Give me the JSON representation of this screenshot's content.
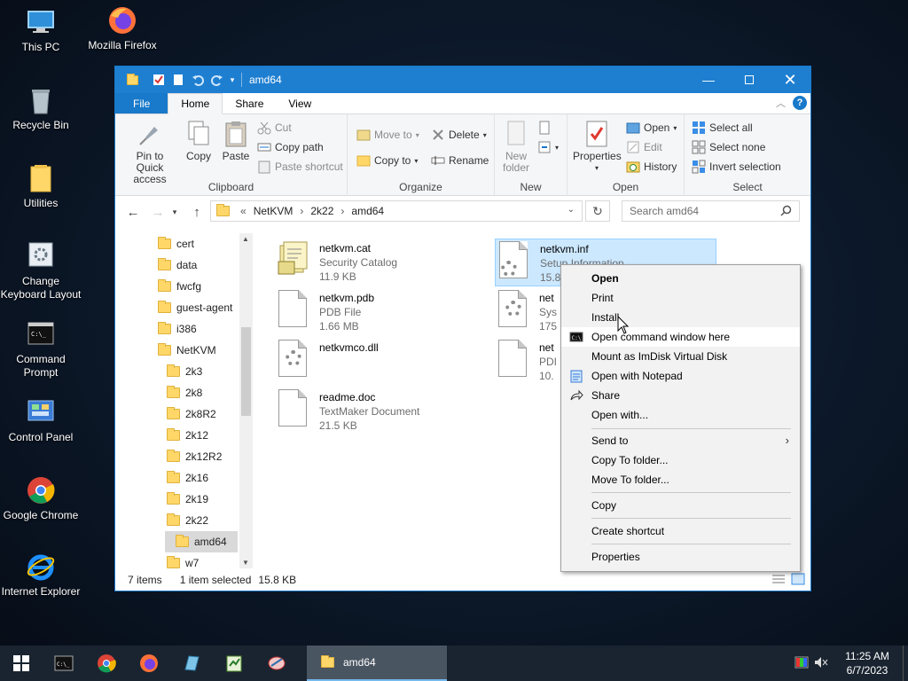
{
  "desktop": {
    "icons": [
      {
        "label": "This PC"
      },
      {
        "label": "Mozilla Firefox"
      },
      {
        "label": "Recycle Bin"
      },
      {
        "label": "Utilities"
      },
      {
        "label": "Change Keyboard Layout"
      },
      {
        "label": "Command Prompt"
      },
      {
        "label": "Control Panel"
      },
      {
        "label": "Google Chrome"
      },
      {
        "label": "Internet Explorer"
      }
    ]
  },
  "window": {
    "title": "amd64",
    "tabs": [
      "File",
      "Home",
      "Share",
      "View"
    ],
    "ribbon": {
      "clipboard": {
        "pin": "Pin to Quick access",
        "copy": "Copy",
        "paste": "Paste",
        "cut": "Cut",
        "copy_path": "Copy path",
        "paste_shortcut": "Paste shortcut",
        "label": "Clipboard"
      },
      "organize": {
        "move_to": "Move to",
        "copy_to": "Copy to",
        "delete": "Delete",
        "rename": "Rename",
        "label": "Organize"
      },
      "new": {
        "new_folder": "New folder",
        "label": "New"
      },
      "open": {
        "properties": "Properties",
        "open": "Open",
        "edit": "Edit",
        "history": "History",
        "label": "Open"
      },
      "select": {
        "select_all": "Select all",
        "select_none": "Select none",
        "invert": "Invert selection",
        "label": "Select"
      }
    },
    "address": {
      "crumbs": [
        "NetKVM",
        "2k22",
        "amd64"
      ],
      "overflow": "«"
    },
    "search": {
      "placeholder": "Search amd64"
    },
    "tree": [
      "cert",
      "data",
      "fwcfg",
      "guest-agent",
      "i386",
      "NetKVM",
      "2k3",
      "2k8",
      "2k8R2",
      "2k12",
      "2k12R2",
      "2k16",
      "2k19",
      "2k22",
      "amd64",
      "w7"
    ],
    "files": [
      {
        "name": "netkvm.cat",
        "type": "Security Catalog",
        "size": "11.9 KB"
      },
      {
        "name": "netkvm.inf",
        "type": "Setup Information",
        "size": "15.8"
      },
      {
        "name": "netkvm.pdb",
        "type": "PDB File",
        "size": "1.66 MB"
      },
      {
        "name": "net",
        "type": "Sys",
        "size": "175"
      },
      {
        "name": "netkvmco.dll",
        "type": "",
        "size": ""
      },
      {
        "name": "net",
        "type": "PDI",
        "size": "10."
      },
      {
        "name": "readme.doc",
        "type": "TextMaker Document",
        "size": "21.5 KB"
      }
    ],
    "status": {
      "count": "7 items",
      "selected": "1 item selected",
      "size": "15.8 KB"
    }
  },
  "context_menu": {
    "items": [
      {
        "label": "Open"
      },
      {
        "label": "Print"
      },
      {
        "label": "Install"
      },
      {
        "label": "Open command window here"
      },
      {
        "label": "Mount as ImDisk Virtual Disk"
      },
      {
        "label": "Open with Notepad"
      },
      {
        "label": "Share"
      },
      {
        "label": "Open with..."
      },
      {
        "label": "Send to"
      },
      {
        "label": "Copy To folder..."
      },
      {
        "label": "Move To folder..."
      },
      {
        "label": "Copy"
      },
      {
        "label": "Create shortcut"
      },
      {
        "label": "Properties"
      }
    ]
  },
  "taskbar": {
    "active_app": "amd64",
    "time": "11:25 AM",
    "date": "6/7/2023"
  }
}
